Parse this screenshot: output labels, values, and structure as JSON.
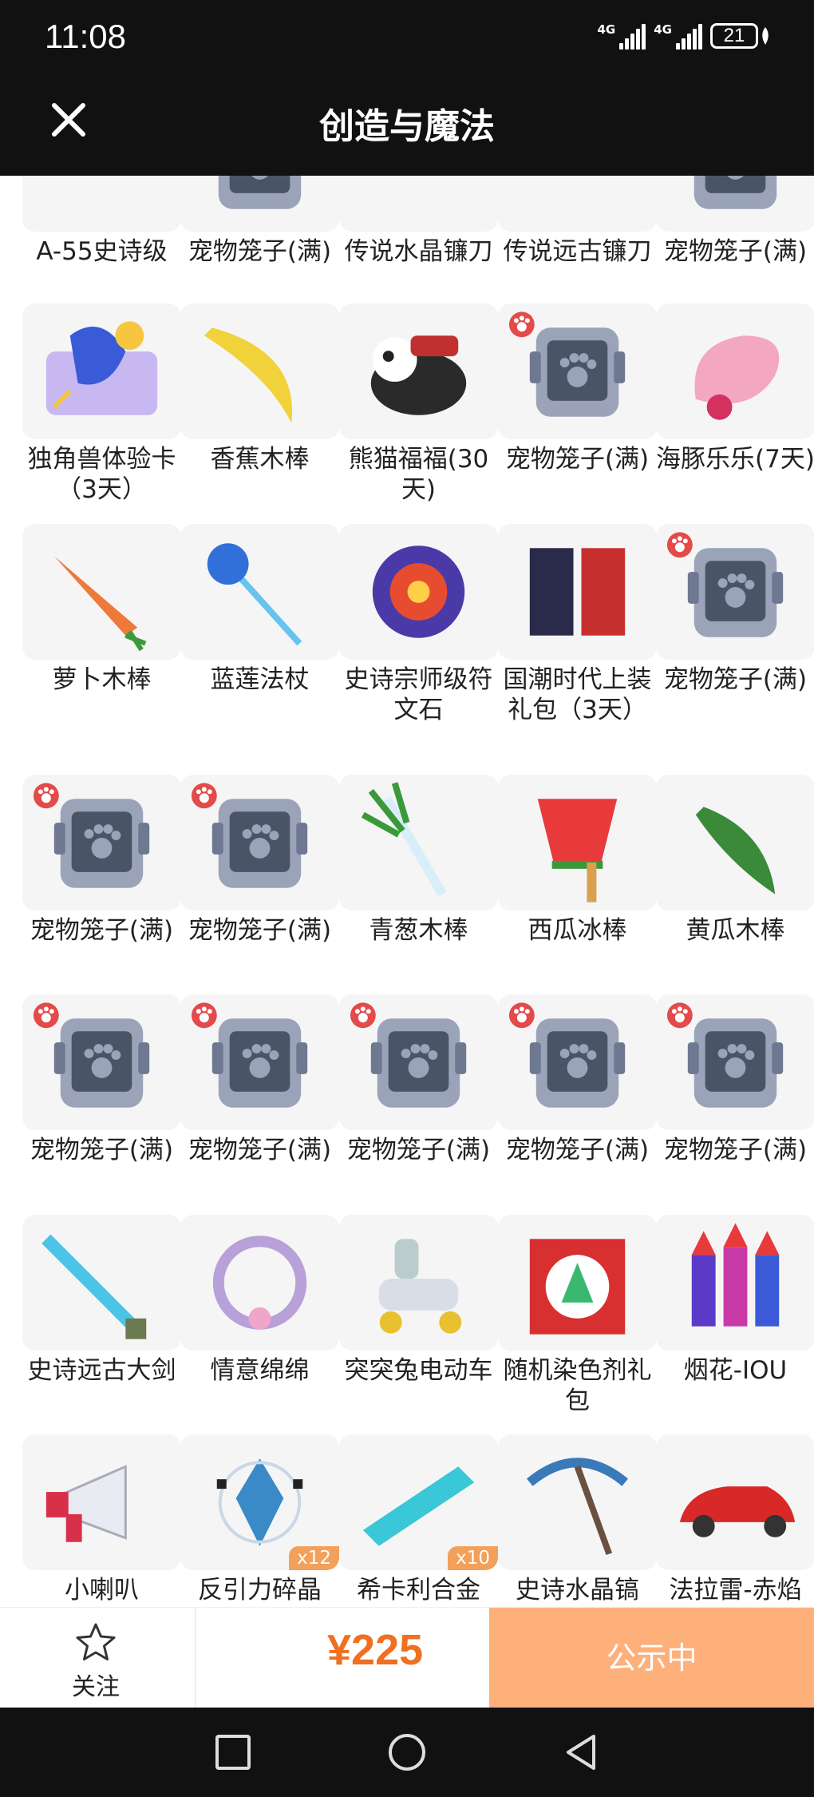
{
  "status_bar": {
    "time": "11:08",
    "signal1": "4G",
    "signal2": "4G",
    "battery": "21"
  },
  "header": {
    "title": "创造与魔法"
  },
  "items": [
    {
      "name": "A-55史诗级",
      "icon": "gun-icon"
    },
    {
      "name": "宠物笼子(满)",
      "icon": "pet-cage-icon"
    },
    {
      "name": "传说水晶镰刀",
      "icon": "scythe-icon"
    },
    {
      "name": "传说远古镰刀",
      "icon": "scythe-icon"
    },
    {
      "name": "宠物笼子(满)",
      "icon": "pet-cage-icon"
    },
    {
      "name": "独角兽体验卡（3天）",
      "icon": "unicorn-card-icon"
    },
    {
      "name": "香蕉木棒",
      "icon": "banana-icon"
    },
    {
      "name": "熊猫福福(30天)",
      "icon": "panda-mount-icon"
    },
    {
      "name": "宠物笼子(满)",
      "icon": "pet-cage-icon"
    },
    {
      "name": "海豚乐乐(7天)",
      "icon": "dolphin-icon"
    },
    {
      "name": "萝卜木棒",
      "icon": "carrot-icon"
    },
    {
      "name": "蓝莲法杖",
      "icon": "staff-icon"
    },
    {
      "name": "史诗宗师级符文石",
      "icon": "rune-stone-icon"
    },
    {
      "name": "国潮时代上装礼包（3天）",
      "icon": "costume-icon"
    },
    {
      "name": "宠物笼子(满)",
      "icon": "pet-cage-icon"
    },
    {
      "name": "宠物笼子(满)",
      "icon": "pet-cage-icon"
    },
    {
      "name": "宠物笼子(满)",
      "icon": "pet-cage-icon"
    },
    {
      "name": "青葱木棒",
      "icon": "scallion-icon"
    },
    {
      "name": "西瓜冰棒",
      "icon": "watermelon-popsicle-icon"
    },
    {
      "name": "黄瓜木棒",
      "icon": "cucumber-icon"
    },
    {
      "name": "宠物笼子(满)",
      "icon": "pet-cage-icon"
    },
    {
      "name": "宠物笼子(满)",
      "icon": "pet-cage-icon"
    },
    {
      "name": "宠物笼子(满)",
      "icon": "pet-cage-icon"
    },
    {
      "name": "宠物笼子(满)",
      "icon": "pet-cage-icon"
    },
    {
      "name": "宠物笼子(满)",
      "icon": "pet-cage-icon"
    },
    {
      "name": "史诗远古大剑",
      "icon": "sword-icon"
    },
    {
      "name": "情意绵绵",
      "icon": "wreath-icon"
    },
    {
      "name": "突突兔电动车",
      "icon": "scooter-icon"
    },
    {
      "name": "随机染色剂礼包",
      "icon": "gift-box-icon"
    },
    {
      "name": "烟花-IOU",
      "icon": "fireworks-icon"
    },
    {
      "name": "小喇叭",
      "icon": "megaphone-icon"
    },
    {
      "name": "反引力碎晶",
      "icon": "crystal-shard-icon",
      "qty": "x12"
    },
    {
      "name": "希卡利合金",
      "icon": "alloy-bar-icon",
      "qty": "x10"
    },
    {
      "name": "史诗水晶镐",
      "icon": "pickaxe-icon"
    },
    {
      "name": "法拉雷-赤焰",
      "icon": "red-car-icon"
    }
  ],
  "bottom_bar": {
    "follow_label": "关注",
    "price": "¥225",
    "status_label": "公示中"
  },
  "colors": {
    "accent": "#f07020",
    "status_button": "#fdb07a",
    "dark": "#111111"
  }
}
